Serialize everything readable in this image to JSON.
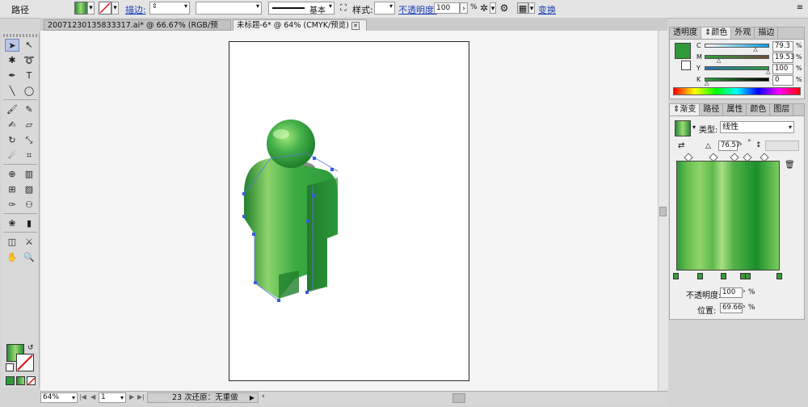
{
  "control_bar": {
    "object_type": "路径",
    "stroke_label": "描边:",
    "brush_label": "基本",
    "style_label": "样式:",
    "opacity_label": "不透明度:",
    "opacity_value": "100",
    "opacity_unit": "%",
    "transform_label": "变换"
  },
  "doc_tabs": [
    {
      "label": "20071230135833317.ai* @ 66.67% (RGB/预览)"
    },
    {
      "label": "未标题-6* @ 64% (CMYK/预览)"
    }
  ],
  "status_bar": {
    "zoom": "64%",
    "page": "1",
    "undo_text": "23 次还原：无重做"
  },
  "color_panel": {
    "tabs": [
      "透明度",
      "颜色",
      "外观",
      "描边"
    ],
    "channels": [
      {
        "label": "C",
        "value": "79.3",
        "fraction": 0.793
      },
      {
        "label": "M",
        "value": "19.53",
        "fraction": 0.195
      },
      {
        "label": "Y",
        "value": "100",
        "fraction": 1.0
      },
      {
        "label": "K",
        "value": "0",
        "fraction": 0.0
      }
    ]
  },
  "gradient_panel": {
    "tabs": [
      "渐变",
      "路径",
      "属性",
      "颜色",
      "图层"
    ],
    "type_label": "类型:",
    "type_value": "线性",
    "angle_value": "76.57",
    "degree_symbol": "°",
    "opacity_label": "不透明度:",
    "opacity_value": "100",
    "opacity_unit": "%",
    "location_label": "位置:",
    "location_value": "69.66",
    "location_unit": "%"
  },
  "colors": {
    "accent_green": "#2f9a3a",
    "light_green": "#8fd36c"
  },
  "toolbar": {
    "icons": [
      "selection-tool-icon",
      "direct-selection-tool-icon",
      "magic-wand-tool-icon",
      "lasso-tool-icon",
      "pen-tool-icon",
      "type-tool-icon",
      "line-tool-icon",
      "ellipse-tool-icon",
      "paintbrush-tool-icon",
      "pencil-tool-icon",
      "blob-brush-tool-icon",
      "eraser-tool-icon",
      "rotate-tool-icon",
      "scale-tool-icon",
      "warp-tool-icon",
      "free-transform-tool-icon",
      "shape-builder-tool-icon",
      "perspective-grid-tool-icon",
      "mesh-tool-icon",
      "gradient-tool-icon",
      "eyedropper-tool-icon",
      "blend-tool-icon",
      "symbol-sprayer-tool-icon",
      "column-graph-tool-icon",
      "artboard-tool-icon",
      "slice-tool-icon",
      "hand-tool-icon",
      "zoom-tool-icon"
    ]
  }
}
